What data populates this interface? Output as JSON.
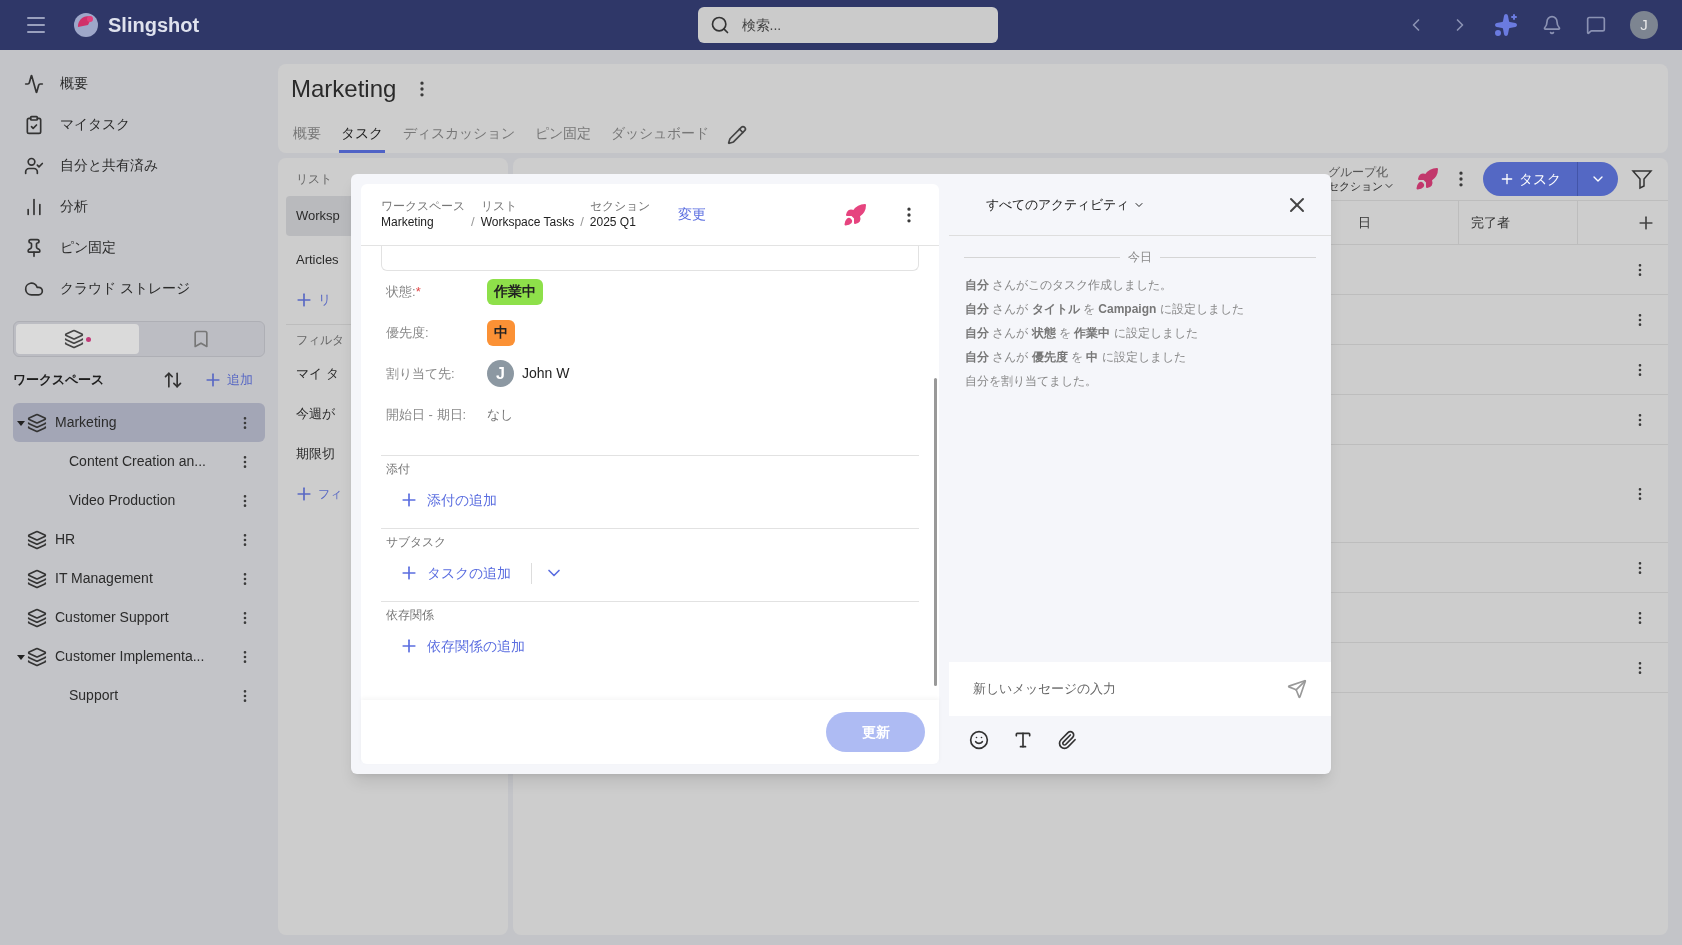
{
  "topbar": {
    "app_name": "Slingshot",
    "search": {
      "placeholder": "検索..."
    },
    "avatar": "J"
  },
  "sidebar": {
    "nav": [
      {
        "label": "概要",
        "selected": false
      },
      {
        "label": "マイタスク",
        "selected": false
      },
      {
        "label": "自分と共有済み",
        "selected": false
      },
      {
        "label": "分析",
        "selected": false
      },
      {
        "label": "ピン固定",
        "selected": false
      },
      {
        "label": "クラウド ストレージ",
        "selected": false
      }
    ],
    "segments": [
      {
        "selected": true
      },
      {
        "selected": false
      }
    ],
    "workspace_header": "ワークスペース",
    "add_label": "追加",
    "tree": [
      {
        "label": "Marketing",
        "selected": true,
        "expanded": true,
        "children": [
          {
            "label": "Content Creation an...",
            "selected": false
          },
          {
            "label": "Video Production",
            "selected": false
          }
        ]
      },
      {
        "label": "HR",
        "selected": false
      },
      {
        "label": "IT Management",
        "selected": false
      },
      {
        "label": "Customer Support",
        "selected": false
      },
      {
        "label": "Customer Implementa...",
        "selected": false,
        "expanded": true,
        "children": [
          {
            "label": "Support",
            "selected": false
          }
        ]
      }
    ]
  },
  "page": {
    "title": "Marketing",
    "tabs": [
      {
        "label": "概要",
        "selected": false
      },
      {
        "label": "タスク",
        "selected": true
      },
      {
        "label": "ディスカッション",
        "selected": false
      },
      {
        "label": "ピン固定",
        "selected": false
      },
      {
        "label": "ダッシュボード",
        "selected": false
      }
    ]
  },
  "list_panel": {
    "header": "リスト",
    "lists": [
      {
        "label": "Worksp",
        "selected": true
      },
      {
        "label": "Articles",
        "selected": false
      }
    ],
    "add_list": "リ",
    "filter_header": "フィルタ",
    "filters": [
      {
        "label": "マイ タ"
      },
      {
        "label": "今週が"
      },
      {
        "label": "期限切"
      }
    ],
    "add_filter": "フィ"
  },
  "table": {
    "group_label": "グループ化",
    "group_value": "セクション",
    "new_task": "タスク",
    "columns": [
      {
        "label": "日"
      },
      {
        "label": "完了者"
      }
    ],
    "rows": [
      {
        "kind": "row"
      },
      {
        "kind": "row"
      },
      {
        "kind": "row"
      },
      {
        "kind": "row"
      },
      {
        "kind": "tall"
      },
      {
        "kind": "row"
      },
      {
        "kind": "row"
      },
      {
        "kind": "row"
      }
    ]
  },
  "task_modal": {
    "breadcrumb": [
      {
        "caption": "ワークスペース",
        "value": "Marketing"
      },
      {
        "separator": "/",
        "caption": "リスト",
        "value": "Workspace Tasks"
      },
      {
        "separator": "/",
        "caption": "セクション",
        "value": "2025 Q1"
      }
    ],
    "change_link": "変更",
    "fields": [
      {
        "kind": "badge",
        "label": "状態:",
        "required_mark": "*",
        "value": "作業中",
        "color": "#8ee04a"
      },
      {
        "kind": "badge",
        "label": "優先度:",
        "value": "中",
        "color": "#fb9135"
      },
      {
        "kind": "person",
        "label": "割り当て先:",
        "avatar": "J",
        "value": "John W"
      },
      {
        "kind": "text",
        "label": "開始日 - 期日:",
        "value": "なし"
      }
    ],
    "sections": [
      {
        "title": "添付",
        "action": "添付の追加",
        "has_menu": false
      },
      {
        "title": "サブタスク",
        "action": "タスクの追加",
        "has_menu": true
      },
      {
        "title": "依存関係",
        "action": "依存関係の追加",
        "has_menu": false
      }
    ],
    "update_button": {
      "label": "更新",
      "disabled": true
    }
  },
  "activity": {
    "filter": "すべてのアクティビティ",
    "day": "今日",
    "entries": [
      "**自分** さんがこのタスク作成しました。",
      "**自分** さんが **タイトル** を **Campaign** に設定しました",
      "**自分** さんが **状態** を **作業中** に設定しました",
      "**自分** さんが **優先度** を **中** に設定しました",
      "自分を割り当てました。"
    ],
    "message": {
      "placeholder": "新しいメッセージの入力"
    }
  }
}
